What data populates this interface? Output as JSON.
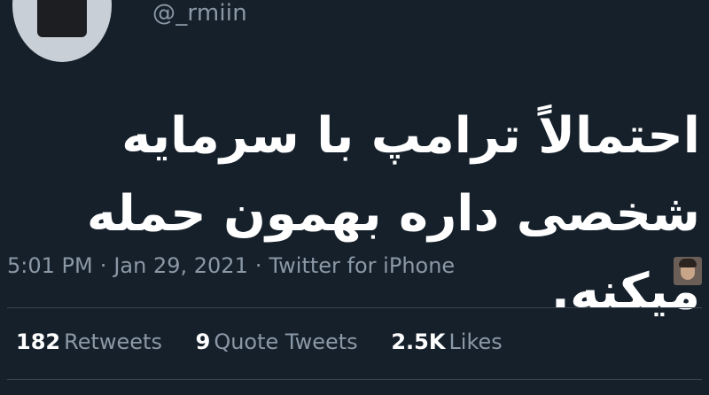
{
  "author": {
    "handle": "@_rmiin"
  },
  "tweet": {
    "text": "احتمالاً ترامپ با سرمایه شخصی داره بهمون حمله میکنه.",
    "time": "5:01 PM",
    "date": "Jan 29, 2021",
    "separator": "·",
    "source": "Twitter for iPhone"
  },
  "stats": {
    "retweets": {
      "count": "182",
      "label": "Retweets"
    },
    "quote_tweets": {
      "count": "9",
      "label": "Quote Tweets"
    },
    "likes": {
      "count": "2.5K",
      "label": "Likes"
    }
  },
  "colors": {
    "background": "#15202b",
    "primary_text": "#ffffff",
    "secondary_text": "#8b98a5",
    "divider": "#38444d"
  }
}
